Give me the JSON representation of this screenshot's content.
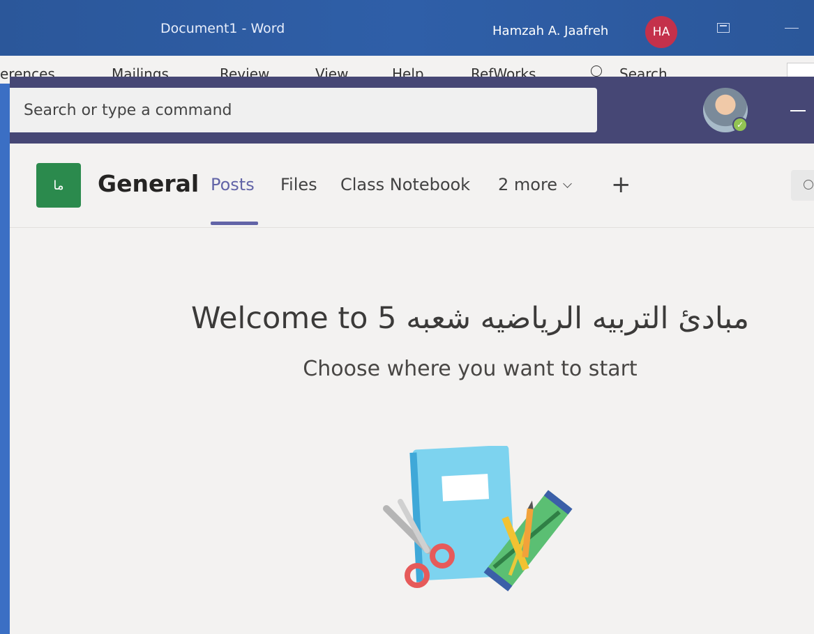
{
  "word": {
    "title": "Document1  -  Word",
    "user_name": "Hamzah A. Jaafreh",
    "user_initials": "HA",
    "ribbon_tabs": [
      "erences",
      "Mailings",
      "Review",
      "View",
      "Help",
      "RefWorks"
    ],
    "search_label": "Search"
  },
  "teams": {
    "command_placeholder": "Search or type a command",
    "team_icon_text": "ما",
    "channel_name": "General",
    "tabs": {
      "posts": "Posts",
      "files": "Files",
      "notebook": "Class Notebook",
      "more": "2 more"
    },
    "accent_color": "#6264a7",
    "header_color": "#464775",
    "team_color": "#2b8a4d",
    "welcome_title": "Welcome to 5 مبادئ التربيه الرياضيه شعبه",
    "welcome_subtitle": "Choose where you want to start"
  }
}
